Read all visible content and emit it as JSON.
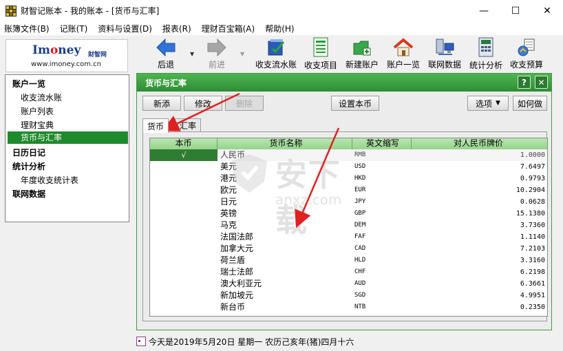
{
  "window": {
    "title": "财智记账本 - 我的账本 - [货币与汇率]",
    "minimize": "—",
    "maximize": "☐",
    "close": "✕"
  },
  "menu": [
    "账簿文件(B)",
    "记账(T)",
    "资料与设置(D)",
    "报表(R)",
    "理财百宝箱(A)",
    "帮助(H)"
  ],
  "logo": {
    "brand_prefix": "Im",
    "brand_o": "o",
    "brand_suffix": "ney",
    "brand_cn": "财智网",
    "url": "www.imoney.com.cn"
  },
  "toolbar": {
    "back": "后退",
    "forward": "前进",
    "journal": "收支流水账",
    "items": "收支项目",
    "new_account": "新建账户",
    "accounts": "账户一览",
    "online": "联网数据",
    "stats": "统计分析",
    "budget": "收支预算"
  },
  "nav": {
    "group_accounts": "账户一览",
    "journal": "收支流水账",
    "account_list": "账户列表",
    "treasury": "理财宝典",
    "currency": "货币与汇率",
    "group_calendar": "日历日记",
    "group_stats": "统计分析",
    "annual_stats": "年度收支统计表",
    "group_online": "联网数据"
  },
  "panel": {
    "title": "货币与汇率",
    "help": "?",
    "close": "✕",
    "buttons": {
      "add": "新添",
      "edit": "修改",
      "delete": "删除",
      "set_base": "设置本币",
      "options": "选项",
      "options_arrow": "▼",
      "howto": "如何做"
    },
    "tabs": {
      "currency": "货币",
      "rate": "汇率"
    }
  },
  "table": {
    "headers": [
      "本币",
      "货币名称",
      "英文缩写",
      "对人民币牌价"
    ],
    "rows": [
      {
        "base": "√",
        "name": "人民币",
        "code": "RMB",
        "rate": "1.0000"
      },
      {
        "base": "",
        "name": "美元",
        "code": "USD",
        "rate": "7.6497"
      },
      {
        "base": "",
        "name": "港元",
        "code": "HKD",
        "rate": "0.9793"
      },
      {
        "base": "",
        "name": "欧元",
        "code": "EUR",
        "rate": "10.2904"
      },
      {
        "base": "",
        "name": "日元",
        "code": "JPY",
        "rate": "0.0628"
      },
      {
        "base": "",
        "name": "英镑",
        "code": "GBP",
        "rate": "15.1380"
      },
      {
        "base": "",
        "name": "马克",
        "code": "DEM",
        "rate": "3.7360"
      },
      {
        "base": "",
        "name": "法国法郎",
        "code": "FAF",
        "rate": "1.1140"
      },
      {
        "base": "",
        "name": "加拿大元",
        "code": "CAD",
        "rate": "7.2103"
      },
      {
        "base": "",
        "name": "荷兰盾",
        "code": "HLD",
        "rate": "3.3160"
      },
      {
        "base": "",
        "name": "瑞士法郎",
        "code": "CHF",
        "rate": "6.2198"
      },
      {
        "base": "",
        "name": "澳大利亚元",
        "code": "AUD",
        "rate": "6.3661"
      },
      {
        "base": "",
        "name": "新加坡元",
        "code": "SGD",
        "rate": "4.9951"
      },
      {
        "base": "",
        "name": "新台币",
        "code": "NTB",
        "rate": "0.2350"
      }
    ]
  },
  "status": {
    "text": "今天是2019年5月20日 星期一 农历己亥年(猪)四月十六"
  },
  "watermark": {
    "cn": "安下载",
    "en": "anxz.com"
  },
  "colors": {
    "accent_green": "#2e8d34",
    "selected_green": "#1f8a2c",
    "header_green": "#96d38c",
    "annotation_red": "#e02020"
  }
}
